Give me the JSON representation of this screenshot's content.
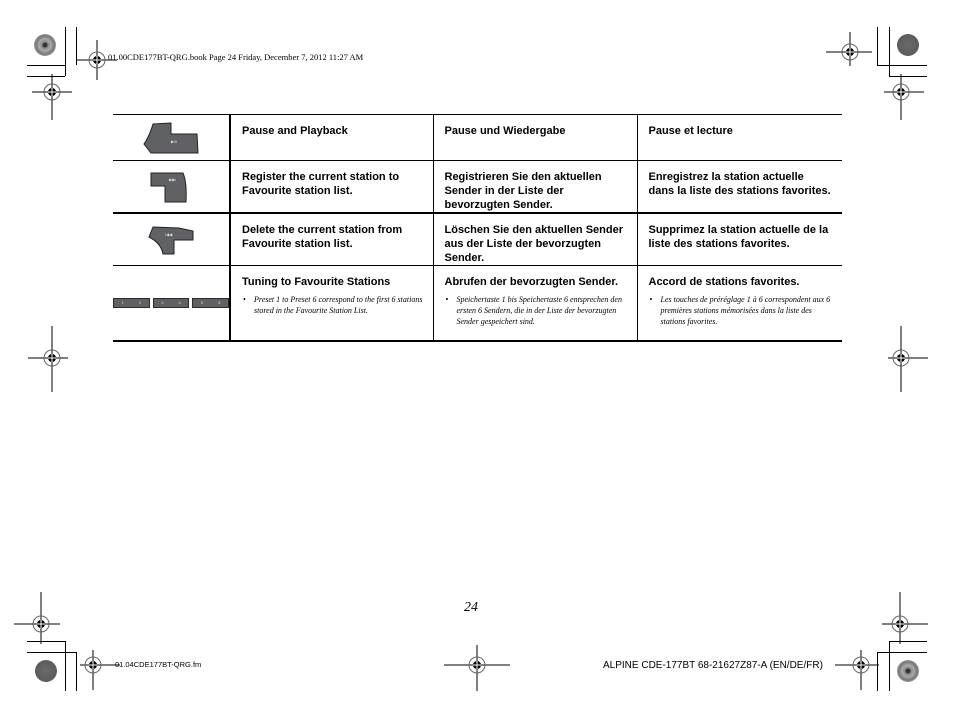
{
  "header": {
    "file_info": "01.00CDE177BT-QRG.book  Page 24  Friday, December 7, 2012  11:27 AM"
  },
  "table": {
    "rows": [
      {
        "icon": "pause-play-button-icon",
        "button_label": "▶/II",
        "en": {
          "title": "Pause and Playback"
        },
        "de": {
          "title": "Pause und Wiedergabe"
        },
        "fr": {
          "title": "Pause et lecture"
        }
      },
      {
        "icon": "next-track-button-icon",
        "button_label": "▶▶I",
        "en": {
          "title": "Register the current station to Favourite station list."
        },
        "de": {
          "title": "Registrieren Sie den aktuellen Sender in der Liste der bevorzugten Sender."
        },
        "fr": {
          "title": "Enregistrez la station actuelle dans la liste des stations favorites."
        }
      },
      {
        "icon": "previous-track-button-icon",
        "button_label": "I◀◀",
        "en": {
          "title": "Delete the current station from Favourite station list."
        },
        "de": {
          "title": "Löschen Sie den aktuellen Sender aus der Liste der bevorzugten Sender."
        },
        "fr": {
          "title": "Supprimez la station actuelle de la liste des stations favorites."
        }
      },
      {
        "icon": "preset-keys-icon",
        "preset_keys": [
          [
            "1",
            "2"
          ],
          [
            "3",
            "4"
          ],
          [
            "5",
            "6"
          ]
        ],
        "en": {
          "title": "Tuning to Favourite Stations",
          "note": "Preset 1 to Preset 6 correspond to the first 6 stations stored in the Favourite Station List."
        },
        "de": {
          "title": "Abrufen der bevorzugten Sender.",
          "note": "Speichertaste 1 bis Speichertaste 6 entsprechen den ersten 6 Sendern, die in der Liste der bevorzugten Sender gespeichert sind."
        },
        "fr": {
          "title": "Accord de stations favorites.",
          "note": "Les touches de préréglage 1 à 6 correspondent aux 6 premières stations mémorisées dans la liste des stations favorites."
        }
      }
    ],
    "bullet": "•"
  },
  "page_number": "24",
  "footer": {
    "file_name": "01.04CDE177BT-QRG.fm",
    "product_code": "ALPINE CDE-177BT 68-21627Z87-A (EN/DE/FR)"
  },
  "colors": {
    "button_fill": "#5f6164",
    "text": "#000000"
  }
}
